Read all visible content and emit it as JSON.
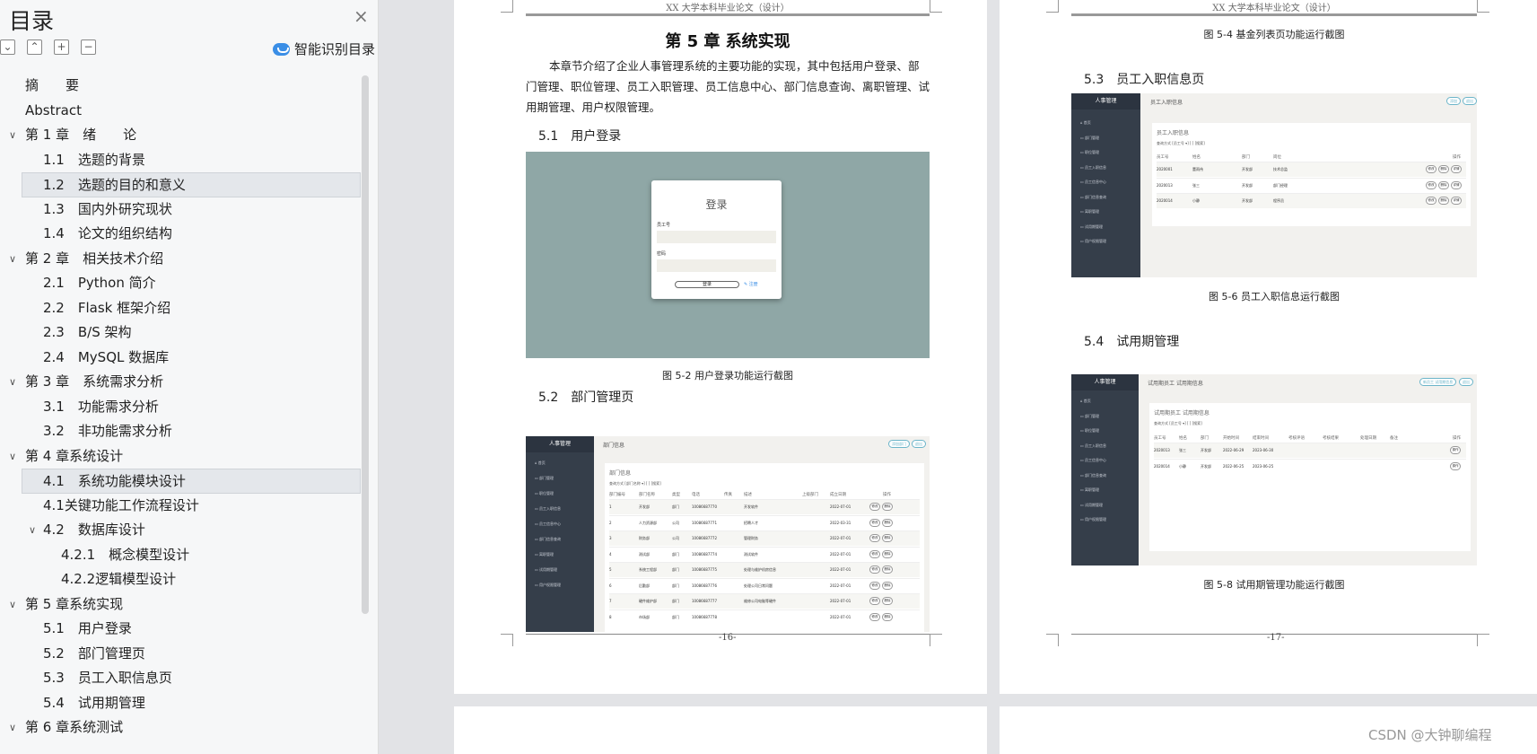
{
  "toc": {
    "title": "目录",
    "close_icon": "×",
    "smart_label": "智能识别目录",
    "items": [
      {
        "label": "摘　　要",
        "level": 1,
        "arrow": "none",
        "selected": false
      },
      {
        "label": "Abstract",
        "level": 1,
        "arrow": "none",
        "selected": false
      },
      {
        "label": "第 1 章　绪　　论",
        "level": 0,
        "arrow": "down",
        "selected": false
      },
      {
        "label": "1.1　选题的背景",
        "level": 2,
        "arrow": "none",
        "selected": false
      },
      {
        "label": "1.2　选题的目的和意义",
        "level": 2,
        "arrow": "none",
        "selected": true
      },
      {
        "label": "1.3　国内外研究现状",
        "level": 2,
        "arrow": "none",
        "selected": false
      },
      {
        "label": "1.4　论文的组织结构",
        "level": 2,
        "arrow": "none",
        "selected": false
      },
      {
        "label": "第 2 章　相关技术介绍",
        "level": 0,
        "arrow": "down",
        "selected": false
      },
      {
        "label": "2.1　Python 简介",
        "level": 2,
        "arrow": "none",
        "selected": false
      },
      {
        "label": "2.2　Flask 框架介绍",
        "level": 2,
        "arrow": "none",
        "selected": false
      },
      {
        "label": "2.3　B/S 架构",
        "level": 2,
        "arrow": "none",
        "selected": false
      },
      {
        "label": "2.4　MySQL 数据库",
        "level": 2,
        "arrow": "none",
        "selected": false
      },
      {
        "label": "第 3 章　系统需求分析",
        "level": 0,
        "arrow": "down",
        "selected": false
      },
      {
        "label": "3.1　功能需求分析",
        "level": 2,
        "arrow": "none",
        "selected": false
      },
      {
        "label": "3.2　非功能需求分析",
        "level": 2,
        "arrow": "none",
        "selected": false
      },
      {
        "label": "第 4 章系统设计",
        "level": 0,
        "arrow": "down",
        "selected": false
      },
      {
        "label": "4.1　系统功能模块设计",
        "level": 2,
        "arrow": "none",
        "selected": true
      },
      {
        "label": "4.1关键功能工作流程设计",
        "level": 2,
        "arrow": "none",
        "selected": false
      },
      {
        "label": "4.2　数据库设计",
        "level": 1.5,
        "arrow": "down",
        "selected": false
      },
      {
        "label": "4.2.1　概念模型设计",
        "level": 3,
        "arrow": "none",
        "selected": false
      },
      {
        "label": "4.2.2逻辑模型设计",
        "level": 3,
        "arrow": "none",
        "selected": false
      },
      {
        "label": "第 5 章系统实现",
        "level": 0,
        "arrow": "down",
        "selected": false
      },
      {
        "label": "5.1　用户登录",
        "level": 2,
        "arrow": "none",
        "selected": false
      },
      {
        "label": "5.2　部门管理页",
        "level": 2,
        "arrow": "none",
        "selected": false
      },
      {
        "label": "5.3　员工入职信息页",
        "level": 2,
        "arrow": "none",
        "selected": false
      },
      {
        "label": "5.4　试用期管理",
        "level": 2,
        "arrow": "none",
        "selected": false
      },
      {
        "label": "第 6 章系统测试",
        "level": 0,
        "arrow": "down",
        "selected": false
      }
    ]
  },
  "header_text": "XX 大学本科毕业论文（设计）",
  "page16": {
    "chapter_title": "第 5 章  系统实现",
    "intro": "本章节介绍了企业人事管理系统的主要功能的实现，其中包括用户登录、部门管理、职位管理、员工入职管理、员工信息中心、部门信息查询、离职管理、试用期管理、用户权限管理。",
    "sec_5_1": "5.1　用户登录",
    "login": {
      "title": "登录",
      "emp_label": "员工号",
      "pwd_label": "密码",
      "btn": "登录",
      "register": "✎ 注册"
    },
    "cap_5_2": "图 5-2  用户登录功能运行截图",
    "sec_5_2": "5.2　部门管理页",
    "dept": {
      "brand": "人事管理",
      "page_title": "部门信息",
      "pill1": "添加部门",
      "pill2": "退出",
      "card_title": "部门信息",
      "search": "查询方式  [部门名称 ▾] [          ] [搜索]",
      "headers": [
        "部门编号",
        "部门名称",
        "类型",
        "电话",
        "传真",
        "描述",
        "上级部门",
        "成立日期",
        "操作"
      ],
      "rows": [
        [
          "1",
          "开发部",
          "部门",
          "10086687770",
          "",
          "开发软件",
          "",
          "2022-07-01"
        ],
        [
          "2",
          "人力资源部",
          "公司",
          "10086687771",
          "",
          "招聘人才",
          "",
          "2022-03-31"
        ],
        [
          "3",
          "财务部",
          "公司",
          "10086687772",
          "",
          "管理财务",
          "",
          "2022-07-01"
        ],
        [
          "4",
          "测试部",
          "部门",
          "10086687774",
          "",
          "测试软件",
          "",
          "2022-07-01"
        ],
        [
          "5",
          "系统工程部",
          "部门",
          "10086687775",
          "",
          "处理与维护机房信息",
          "",
          "2022-07-01"
        ],
        [
          "6",
          "后勤部",
          "部门",
          "10086687776",
          "",
          "处理公司日常问题",
          "",
          "2022-07-01"
        ],
        [
          "7",
          "硬件维护部",
          "部门",
          "10086687777",
          "",
          "维修公司电脑等硬件",
          "",
          "2022-07-01"
        ],
        [
          "8",
          "市场部",
          "部门",
          "10086687778",
          "",
          "",
          "",
          "2022-07-01"
        ]
      ],
      "btn_edit": "修改",
      "btn_del": "删除",
      "nav": [
        "首页",
        "部门管理",
        "职位管理",
        "员工入职信息",
        "员工信息中心",
        "部门信息查询",
        "离职管理",
        "试用期管理",
        "用户权限管理"
      ]
    },
    "page_no": "-16-"
  },
  "page17": {
    "cap_5_4": "图 5-4  基金列表页功能运行截图",
    "sec_5_3": "5.3　员工入职信息页",
    "hire": {
      "brand": "人事管理",
      "page_title": "员工入职信息",
      "pill1": "添加",
      "pill2": "退出",
      "card_title": "员工入职信息",
      "search": "查询方式 [员工号 ▾] [          ] [搜索]",
      "headers": [
        "员工号",
        "姓名",
        "部门",
        "岗位",
        "操作"
      ],
      "rows": [
        [
          "2020001",
          "董雨伟",
          "开发部",
          "技术总监"
        ],
        [
          "2020013",
          "张三",
          "开发部",
          "部门经理"
        ],
        [
          "2020014",
          "小静",
          "开发部",
          "程序员"
        ]
      ],
      "btns": [
        "修改",
        "删除",
        "详情"
      ]
    },
    "cap_5_6": "图 5-6  员工入职信息运行截图",
    "sec_5_4": "5.4　试用期管理",
    "prob": {
      "brand": "人事管理",
      "page_title": "试用期员工 试用期信息",
      "pill1": "新员工 试用期信息",
      "pill2": "退出",
      "card_title": "试用期员工 试用期信息",
      "search": "查询方式 [员工号 ▾] [          ] [搜索]",
      "headers": [
        "员工号",
        "姓名",
        "部门",
        "开始时间",
        "结束时间",
        "考核评语",
        "考核结果",
        "处理日期",
        "备注",
        "操作"
      ],
      "rows": [
        [
          "2020013",
          "张三",
          "开发部",
          "2022-06-29",
          "2023-06-30",
          "",
          "",
          "",
          ""
        ],
        [
          "2020014",
          "小静",
          "开发部",
          "2022-06-25",
          "2023-06-25",
          "",
          "",
          "",
          ""
        ]
      ],
      "btn": "操作"
    },
    "cap_5_8": "图 5-8  试用期管理功能运行截图",
    "page_no": "-17-"
  },
  "watermark": "CSDN @大钟聊编程"
}
